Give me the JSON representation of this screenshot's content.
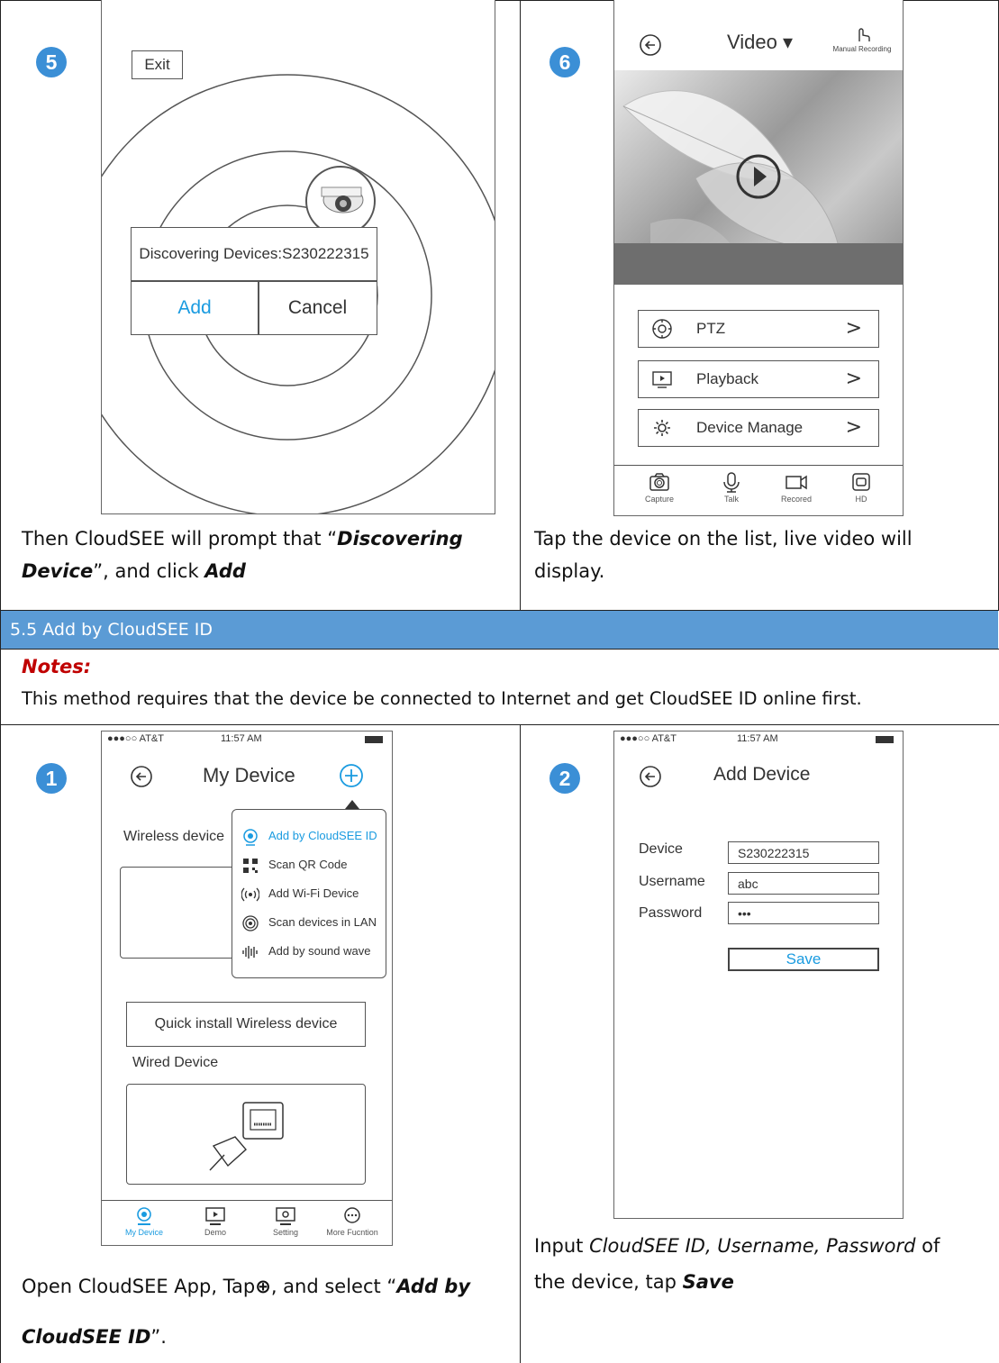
{
  "step5": {
    "number": "5",
    "exit_label": "Exit",
    "discovering_text": "Discovering Devices:S230222315",
    "add_label": "Add",
    "cancel_label": "Cancel",
    "caption_1": "Then CloudSEE will prompt that “",
    "caption_bold_1": "Discovering",
    "caption_bold_2": "Device",
    "caption_2": "”, and click ",
    "caption_bold_3": "Add"
  },
  "step6": {
    "number": "6",
    "title": "Video ▾",
    "manual_recording": "Manual Recording",
    "menu": [
      {
        "label": "PTZ",
        "icon": "ptz-icon"
      },
      {
        "label": "Playback",
        "icon": "playback-icon"
      },
      {
        "label": "Device Manage",
        "icon": "gear-icon"
      }
    ],
    "chevron": ">",
    "tabs": [
      "Capture",
      "Talk",
      "Recored",
      "HD"
    ],
    "caption_line1": "Tap the device on the list, live video will",
    "caption_line2": "display."
  },
  "section": {
    "title": "5.5 Add by CloudSEE ID",
    "notes_label": "Notes:",
    "notes_text": "This method requires that the device be connected to Internet and get CloudSEE ID online first."
  },
  "step1": {
    "number": "1",
    "status_left": "●●●○○ AT&T",
    "status_time": "11:57 AM",
    "title": "My Device",
    "wireless_label": "Wireless device",
    "dropdown": [
      {
        "label": "Add by CloudSEE ID",
        "icon": "webcam-icon",
        "highlight": true
      },
      {
        "label": "Scan QR Code",
        "icon": "qr-code-icon",
        "highlight": false
      },
      {
        "label": "Add Wi-Fi Device",
        "icon": "wifi-signal-icon",
        "highlight": false
      },
      {
        "label": "Scan devices in LAN",
        "icon": "lan-scan-icon",
        "highlight": false
      },
      {
        "label": "Add by sound wave",
        "icon": "sound-wave-icon",
        "highlight": false
      }
    ],
    "quick_install": "Quick install Wireless device",
    "wired_label": "Wired Device",
    "tabs": [
      "My Device",
      "Demo",
      "Setting",
      "More Fucntion"
    ],
    "caption_1": "Open CloudSEE App, Tap",
    "caption_plus": "⊕",
    "caption_2": ", and select “",
    "caption_bold_1": "Add by",
    "caption_bold_2": "CloudSEE ID",
    "caption_3": "”."
  },
  "step2": {
    "number": "2",
    "status_left": "●●●○○ AT&T",
    "status_time": "11:57 AM",
    "title": "Add Device",
    "device_label": "Device",
    "device_value": "S230222315",
    "username_label": "Username",
    "username_value": "abc",
    "password_label": "Password",
    "password_value": "•••",
    "save_label": "Save",
    "caption_1": "Input ",
    "caption_ital": "CloudSEE ID, Username, Password",
    "caption_2": " of",
    "caption_3": "the device, tap ",
    "caption_bold": "Save"
  },
  "colors": {
    "accent_blue": "#1a9be0",
    "step_circle": "#3b8fd6",
    "section_bar": "#5b9bd5",
    "notes_red": "#c00000"
  }
}
